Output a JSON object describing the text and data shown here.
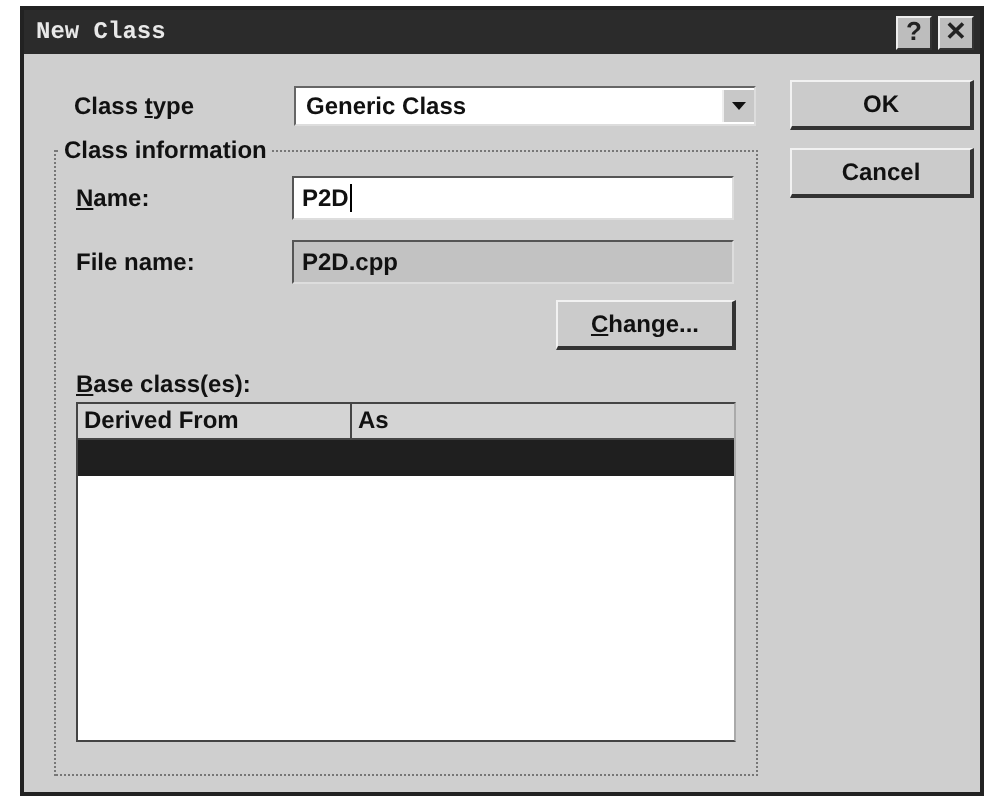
{
  "window": {
    "title": "New Class",
    "title_buttons": [
      {
        "kind": "help",
        "glyph": "?"
      },
      {
        "kind": "close",
        "glyph": "✕"
      }
    ]
  },
  "class_type": {
    "label": {
      "pre": "Class ",
      "key": "t",
      "post": "ype"
    },
    "value": "Generic Class"
  },
  "buttons": [
    {
      "label": {
        "post": "OK"
      }
    },
    {
      "label": {
        "post": "Cancel"
      }
    }
  ],
  "class_information": {
    "title": "Class information",
    "name": {
      "label": {
        "key": "N",
        "post": "ame:"
      },
      "value": "P2D"
    },
    "file_name": {
      "label": {
        "post": "File name:"
      },
      "value": "P2D.cpp"
    },
    "change_button": {
      "label": {
        "key": "C",
        "post": "hange..."
      }
    },
    "base_classes": {
      "label": {
        "key": "B",
        "post": "ase class(es):"
      },
      "columns": [
        "Derived From",
        "As"
      ],
      "rows": [
        {
          "selected": true
        }
      ]
    }
  }
}
